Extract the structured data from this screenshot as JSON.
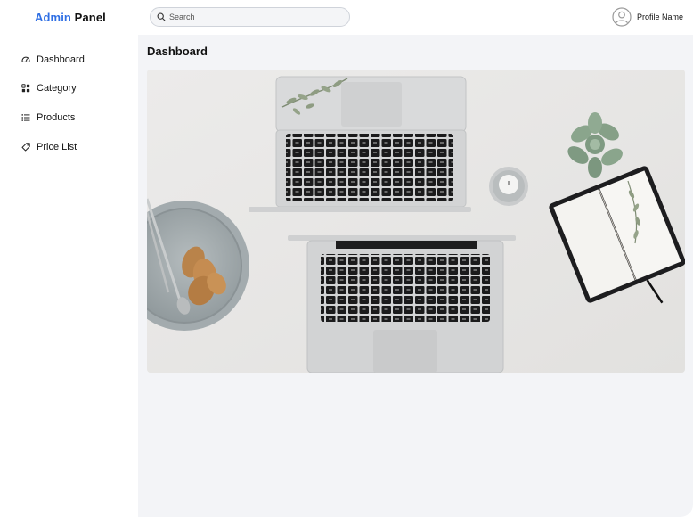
{
  "header": {
    "brand_first": "Admin",
    "brand_second": "Panel",
    "search_placeholder": "Search",
    "profile_name": "Profile Name"
  },
  "sidebar": {
    "items": [
      {
        "label": "Dashboard",
        "icon": "dashboard-icon"
      },
      {
        "label": "Category",
        "icon": "grid-icon"
      },
      {
        "label": "Products",
        "icon": "list-icon"
      },
      {
        "label": "Price List",
        "icon": "tag-icon"
      }
    ]
  },
  "main": {
    "title": "Dashboard",
    "image_alt": "hero-image-workspace-laptops"
  },
  "colors": {
    "brand_accent": "#2f6fe4",
    "main_background": "#f3f4f7",
    "sidebar_background": "#ffffff"
  }
}
